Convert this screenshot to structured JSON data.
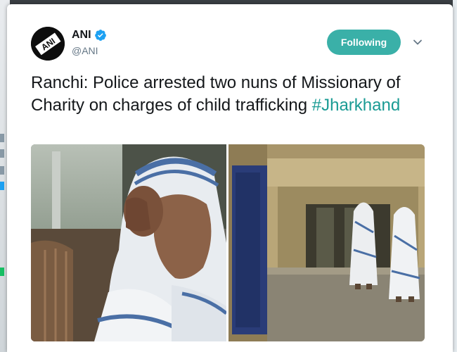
{
  "tweet": {
    "author": {
      "display_name": "ANI",
      "handle": "@ANI",
      "avatar_text": "ANI",
      "verified": true
    },
    "follow_button_label": "Following",
    "text": "Ranchi: Police arrested two nuns of Missionary of Charity on charges of child trafficking ",
    "hashtag": "#Jharkhand",
    "media_count": 2
  },
  "colors": {
    "accent": "#3ab0a8",
    "hashtag": "#1a9b94",
    "verified": "#1da1f2",
    "text": "#14171a",
    "secondary_text": "#657786"
  }
}
